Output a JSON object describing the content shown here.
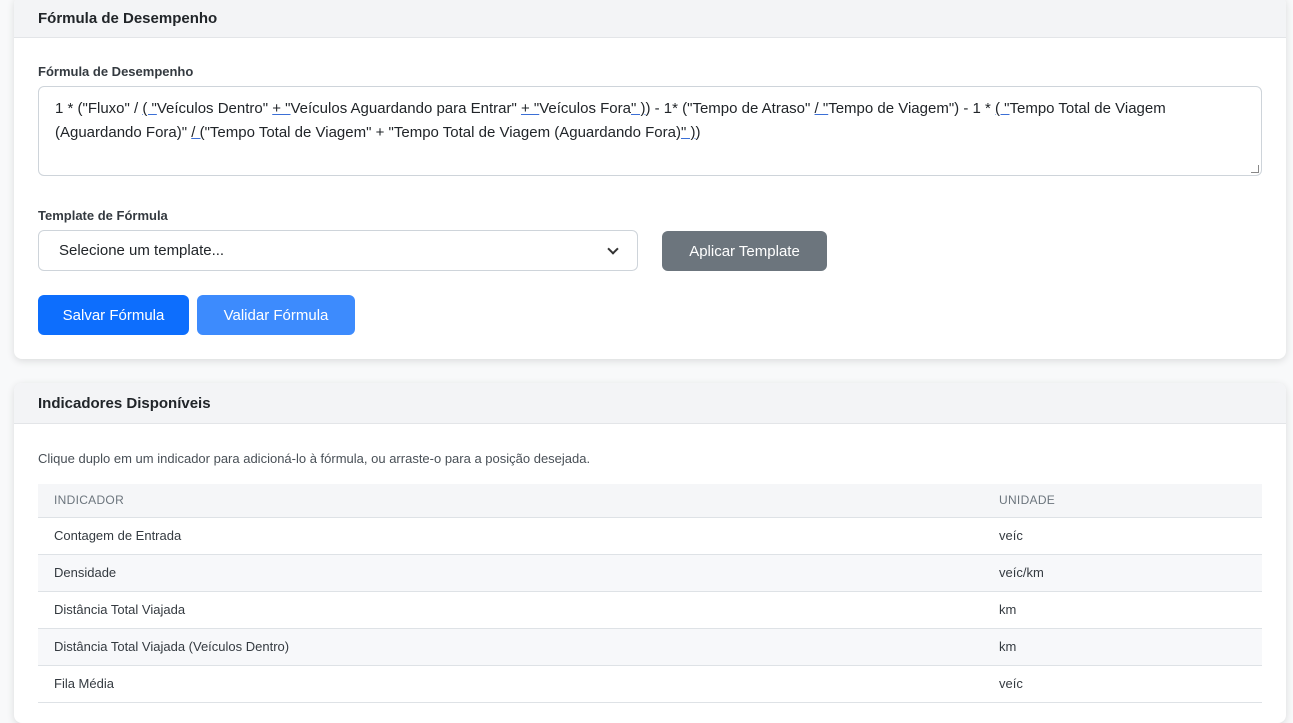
{
  "formula_card": {
    "title": "Fórmula de Desempenho",
    "formula_label": "Fórmula de Desempenho",
    "formula_parts": [
      "1 * (\"Fluxo\" / ",
      "( \"",
      "Veículos Dentro\" ",
      "+ \"",
      "Veículos Aguardando para Entrar\" ",
      "+ \"",
      "Veículos Fora",
      "\" )",
      ") - 1* (\"Tempo de Atraso\" ",
      "/ \"",
      "Tempo de Viagem\") - 1 * ",
      "( \"",
      "Tempo Total de Viagem (Aguardando Fora)\" ",
      "/ (",
      "\"Tempo Total de Viagem\" + \"Tempo Total de Viagem (Aguardando Fora)",
      "\" )",
      ")"
    ],
    "template_label": "Template de Fórmula",
    "template_select_value": "Selecione um template...",
    "apply_button": "Aplicar Template",
    "save_button": "Salvar Fórmula",
    "validate_button": "Validar Fórmula"
  },
  "indicators_card": {
    "title": "Indicadores Disponíveis",
    "hint": "Clique duplo em um indicador para adicioná-lo à fórmula, ou arraste-o para a posição desejada.",
    "columns": [
      "INDICADOR",
      "UNIDADE"
    ],
    "rows": [
      {
        "indicator": "Contagem de Entrada",
        "unit": "veíc"
      },
      {
        "indicator": "Densidade",
        "unit": "veíc/km"
      },
      {
        "indicator": "Distância Total Viajada",
        "unit": "km"
      },
      {
        "indicator": "Distância Total Viajada (Veículos Dentro)",
        "unit": "km"
      },
      {
        "indicator": "Fila Média",
        "unit": "veíc"
      }
    ]
  }
}
